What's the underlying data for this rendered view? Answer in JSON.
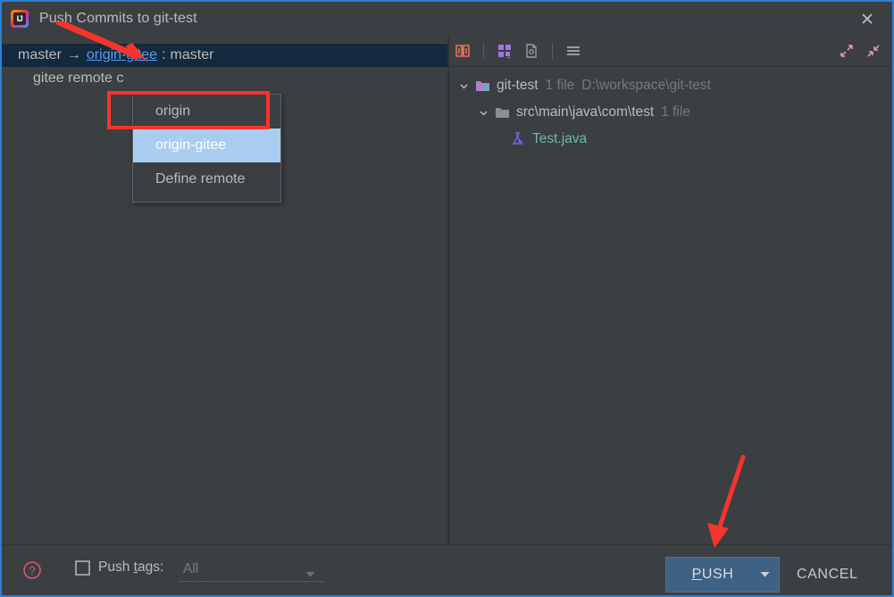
{
  "window": {
    "title": "Push Commits to git-test",
    "app_icon": "intellij-idea-icon",
    "close_icon": "close-icon",
    "accent_border": "#2d7fd6",
    "background": "#3c3f41"
  },
  "left_pane": {
    "branch_row": {
      "local_branch": "master",
      "arrow": "→",
      "remote_link": "origin-gitee",
      "colon": ":",
      "remote_branch": "master",
      "selected_background": "#13293d",
      "link_color": "#589df6"
    },
    "commit_row": {
      "message": "gitee remote c"
    }
  },
  "remote_menu": {
    "items": [
      {
        "label": "origin",
        "selected": false
      },
      {
        "label": "origin-gitee",
        "selected": true
      },
      {
        "label": "Define remote",
        "selected": false
      }
    ],
    "selected_background": "#a9cdf0"
  },
  "annotations": {
    "highlight_color": "#f5352b",
    "rect_target": "origin-gitee-menu-item",
    "arrow_to_remote_link": "red-arrow-down-right",
    "arrow_to_push_button": "red-arrow-down"
  },
  "right_pane": {
    "toolbar": {
      "buttons": [
        {
          "name": "show-diff-icon",
          "tooltip": "Show Diff"
        },
        {
          "name": "group-by-icon",
          "tooltip": "Group By"
        },
        {
          "name": "show-file-history-icon",
          "tooltip": "File"
        },
        {
          "name": "list-options-icon",
          "tooltip": "Options"
        }
      ],
      "right_buttons": [
        {
          "name": "expand-all-icon",
          "tooltip": "Expand All"
        },
        {
          "name": "collapse-all-icon",
          "tooltip": "Collapse All"
        }
      ]
    },
    "tree": [
      {
        "level": 0,
        "chevron": "expanded",
        "icon": "module-folder-icon",
        "name": "git-test",
        "count": "1 file",
        "path": "D:\\workspace\\git-test",
        "style": "normal"
      },
      {
        "level": 1,
        "chevron": "expanded",
        "icon": "folder-icon",
        "name": "src\\main\\java\\com\\test",
        "count": "1 file",
        "path": "",
        "style": "normal"
      },
      {
        "level": 2,
        "chevron": "none",
        "icon": "java-test-file-icon",
        "name": "Test.java",
        "count": "",
        "path": "",
        "style": "added"
      }
    ]
  },
  "bottom_bar": {
    "help_icon": "help-circle-icon",
    "push_tags": {
      "checked": false,
      "label_before": "Push ",
      "label_mnemonic": "t",
      "label_after": "ags:",
      "combo_value": "All"
    },
    "push_button": {
      "mnemonic": "P",
      "label_rest": "USH",
      "dropdown_icon": "chevron-down-icon",
      "background": "#3e6184"
    },
    "cancel_button": {
      "label": "CANCEL"
    }
  }
}
